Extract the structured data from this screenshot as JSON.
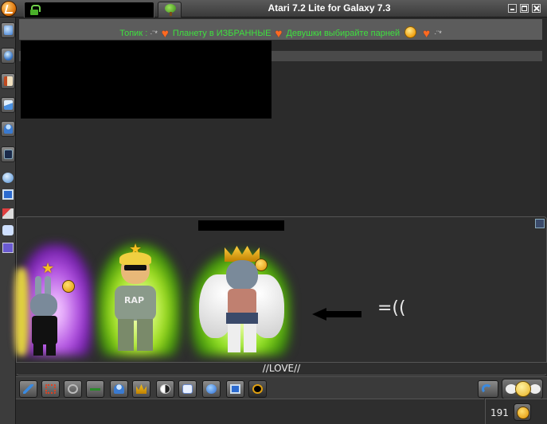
{
  "window": {
    "title": "Atari 7.2 Lite for Galaxy 7.3"
  },
  "topic": {
    "label": "Топик :",
    "sparkle_1": "·¨*",
    "part_1": "Планету в ИЗБРАННЫЕ",
    "part_2": "Девушки выбирайте парней",
    "sparkle_2": "·¨*"
  },
  "room": {
    "status_text": "=((",
    "nickname_line": "//LOVE//"
  },
  "input": {
    "value": ""
  },
  "counter": {
    "value": "191"
  },
  "colors": {
    "topic_text": "#3fe03f",
    "accent_heart": "#ff6a20",
    "background": "#2b2b2b"
  }
}
